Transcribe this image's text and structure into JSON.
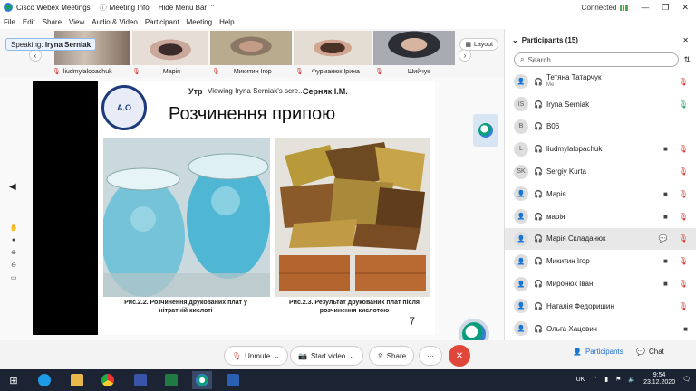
{
  "titlebar": {
    "app_title": "Cisco Webex Meetings",
    "meeting_info": "Meeting Info",
    "hide_menu": "Hide Menu Bar",
    "status": "Connected"
  },
  "menu": [
    "File",
    "Edit",
    "Share",
    "View",
    "Audio & Video",
    "Participant",
    "Meeting",
    "Help"
  ],
  "filmstrip": {
    "speaking_prefix": "Speaking:",
    "speaking_name": "Iryna Serniak",
    "layout_label": "Layout",
    "tiles": [
      {
        "name": "liudmylalopachuk"
      },
      {
        "name": "Марія"
      },
      {
        "name": "Микитин Ігор"
      },
      {
        "name": "Фурманюк Ірина"
      },
      {
        "name": "Шийчук"
      }
    ]
  },
  "slide": {
    "header_left": "Утр",
    "viewing": "Viewing Iryna Serniak's scre...",
    "header_right": "Серняк І.М.",
    "title": "Розчинення припою",
    "caption1": "Рис.2.2. Розчинення друкованих плат у нітратній кислоті",
    "caption2": "Рис.2.3. Результат друкованих плат після розчинення кислотою",
    "page": "7",
    "logo_text": "A.O"
  },
  "panel": {
    "title": "Participants (15)",
    "search_placeholder": "Search",
    "participants": [
      {
        "name": "Тетяна Татарчук",
        "sub": "Me",
        "avatar": "",
        "mic": "muted",
        "cam": false
      },
      {
        "name": "Iryna Serniak",
        "sub": "",
        "avatar": "IS",
        "mic": "unmuted",
        "cam": false
      },
      {
        "name": "B06",
        "sub": "",
        "avatar": "B",
        "mic": "",
        "cam": false
      },
      {
        "name": "liudmylalopachuk",
        "sub": "",
        "avatar": "L",
        "mic": "muted",
        "cam": true
      },
      {
        "name": "Sergiy Kurta",
        "sub": "",
        "avatar": "SK",
        "mic": "muted",
        "cam": false
      },
      {
        "name": "Марія",
        "sub": "",
        "avatar": "",
        "mic": "muted",
        "cam": true
      },
      {
        "name": "марія",
        "sub": "",
        "avatar": "",
        "mic": "muted",
        "cam": true
      },
      {
        "name": "Марія Складанюк",
        "sub": "",
        "avatar": "",
        "mic": "muted",
        "cam": false,
        "chat": true
      },
      {
        "name": "Микитин Ігор",
        "sub": "",
        "avatar": "",
        "mic": "muted",
        "cam": true
      },
      {
        "name": "Миронюк Іван",
        "sub": "",
        "avatar": "",
        "mic": "muted",
        "cam": true
      },
      {
        "name": "Наталія Федоришин",
        "sub": "",
        "avatar": "",
        "mic": "muted",
        "cam": false
      },
      {
        "name": "Ольга Хацевич",
        "sub": "",
        "avatar": "",
        "mic": "",
        "cam": true
      }
    ]
  },
  "toolbar": {
    "unmute": "Unmute",
    "start_video": "Start video",
    "share": "Share",
    "more": "···",
    "participants": "Participants",
    "chat": "Chat"
  },
  "taskbar": {
    "lang": "UK",
    "time": "9:54",
    "date": "23.12.2020"
  },
  "colors": {
    "accent": "#0a9e7b",
    "end_call": "#e0463a",
    "muted": "#d4372c"
  }
}
